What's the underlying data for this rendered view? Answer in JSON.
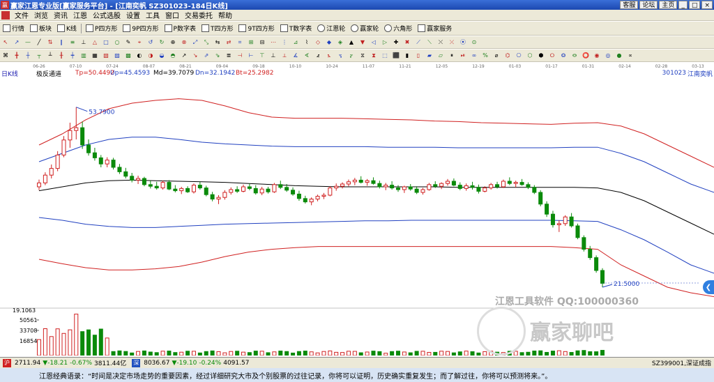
{
  "titlebar": {
    "title": "赢家江恩专业版[赢家服务平台] - [江南奕帆  SZ301023-184日K线]",
    "buttons": [
      "客服",
      "论坛",
      "主页"
    ]
  },
  "menu": [
    "文件",
    "浏览",
    "资讯",
    "江恩",
    "公式选股",
    "设置",
    "工具",
    "窗口",
    "交易委托",
    "帮助"
  ],
  "toolbar1": [
    "行情",
    "板块",
    "K线",
    "P四方形",
    "9P四方形",
    "P数字表",
    "T四方形",
    "9T四方形",
    "T数字表",
    "江恩轮",
    "赢家轮",
    "六角形",
    "赢家服务"
  ],
  "dates": [
    "06-26",
    "07-10",
    "07-24",
    "08-07",
    "08-21",
    "09-04",
    "09-18",
    "10-10",
    "10-24",
    "11-07",
    "11-21",
    "12-05",
    "12-19",
    "01-03",
    "01-17",
    "01-31",
    "02-14",
    "02-28",
    "03-13"
  ],
  "chartinfo": {
    "period": "日K线",
    "indicator": "极反通道",
    "tp": "Tp=50.4492",
    "up": "Up=45.4593",
    "md": "Md=39.7079",
    "dn": "Dn=32.1942",
    "bt": "Bt=25.2982",
    "code": "301023",
    "name": "江南奕帆"
  },
  "annotations": {
    "high": "53.7900",
    "low": "21.5000",
    "vol_max": "19.1063",
    "vol_ticks": [
      "50561",
      "33708",
      "16854"
    ]
  },
  "watermark": {
    "line1": "江恩工具软件  QQ:100000360",
    "line2": "赢家聊吧"
  },
  "bottombar": {
    "sh_index": "2711.94",
    "sh_change": "▼-18.21",
    "sh_pct": "-0.67%",
    "sh_amount": "3811.44亿",
    "sz_index": "8036.67",
    "sz_change": "▼-19.10",
    "sz_pct": "-0.24%",
    "sz_amount": "4091.57",
    "right": "SZ399001,深证成指"
  },
  "quote": "江恩经典语录：“时间是决定市场走势的重要因素，经过详细研究大市及个别股票的过往记录，你将可以证明，历史确实重复发生；而了解过往，你将可以预测将来。”。",
  "colors": {
    "up": "#d02020",
    "down": "#0a8a0a",
    "channel_outer": "#d02020",
    "channel_inner": "#2040c0",
    "mid": "#000000"
  },
  "chart_data": {
    "type": "candlestick",
    "indicator": "极反通道",
    "ylim": [
      19,
      60
    ],
    "candles": [
      [
        39.5,
        40.8,
        38.9,
        40.2
      ],
      [
        40.2,
        42.1,
        39.8,
        41.6
      ],
      [
        41.6,
        43.5,
        41.0,
        42.8
      ],
      [
        42.8,
        45.9,
        42.3,
        45.2
      ],
      [
        45.2,
        48.6,
        44.8,
        47.9
      ],
      [
        47.9,
        51.0,
        46.5,
        49.6
      ],
      [
        49.6,
        53.79,
        48.0,
        50.1
      ],
      [
        50.1,
        51.2,
        46.3,
        47.0
      ],
      [
        47.0,
        48.0,
        45.1,
        45.6
      ],
      [
        45.6,
        46.5,
        44.2,
        44.7
      ],
      [
        44.7,
        45.2,
        43.0,
        43.6
      ],
      [
        43.6,
        44.8,
        43.0,
        44.3
      ],
      [
        44.3,
        44.7,
        42.6,
        43.0
      ],
      [
        43.0,
        43.6,
        41.8,
        42.2
      ],
      [
        42.2,
        42.9,
        41.0,
        41.4
      ],
      [
        41.4,
        42.0,
        40.3,
        40.7
      ],
      [
        40.7,
        41.5,
        40.0,
        41.0
      ],
      [
        41.0,
        41.3,
        39.6,
        39.9
      ],
      [
        39.9,
        40.6,
        39.2,
        39.6
      ],
      [
        39.6,
        40.4,
        39.0,
        39.3
      ],
      [
        39.3,
        40.6,
        39.0,
        40.3
      ],
      [
        40.3,
        40.7,
        38.9,
        39.1
      ],
      [
        39.1,
        39.8,
        38.5,
        38.8
      ],
      [
        38.8,
        39.5,
        38.2,
        39.2
      ],
      [
        39.2,
        39.6,
        38.4,
        38.6
      ],
      [
        38.6,
        40.1,
        38.3,
        39.8
      ],
      [
        39.8,
        40.4,
        39.0,
        39.3
      ],
      [
        39.3,
        39.7,
        37.8,
        38.1
      ],
      [
        38.1,
        38.6,
        36.9,
        37.3
      ],
      [
        37.3,
        38.0,
        36.4,
        37.6
      ],
      [
        37.6,
        38.9,
        37.2,
        38.5
      ],
      [
        38.5,
        39.4,
        38.1,
        39.0
      ],
      [
        39.0,
        39.6,
        38.4,
        38.7
      ],
      [
        38.7,
        39.9,
        38.5,
        39.5
      ],
      [
        39.5,
        40.1,
        38.9,
        39.2
      ],
      [
        39.2,
        39.8,
        38.1,
        38.4
      ],
      [
        38.4,
        39.5,
        38.0,
        39.1
      ],
      [
        39.1,
        39.5,
        38.3,
        38.6
      ],
      [
        38.6,
        40.2,
        38.4,
        39.9
      ],
      [
        39.9,
        40.6,
        39.1,
        39.4
      ],
      [
        39.4,
        40.0,
        38.6,
        38.9
      ],
      [
        38.9,
        39.4,
        37.9,
        38.2
      ],
      [
        38.2,
        38.8,
        37.0,
        37.4
      ],
      [
        37.4,
        37.9,
        36.5,
        36.8
      ],
      [
        36.8,
        37.6,
        36.2,
        37.3
      ],
      [
        37.3,
        38.1,
        36.9,
        37.8
      ],
      [
        37.8,
        38.4,
        37.3,
        38.0
      ],
      [
        38.0,
        39.6,
        37.8,
        39.3
      ],
      [
        39.3,
        40.1,
        38.8,
        39.6
      ],
      [
        39.6,
        40.3,
        39.2,
        40.0
      ],
      [
        40.0,
        40.8,
        39.6,
        40.4
      ],
      [
        40.4,
        41.1,
        39.8,
        40.7
      ],
      [
        40.7,
        41.4,
        40.1,
        40.3
      ],
      [
        40.3,
        40.9,
        39.7,
        40.6
      ],
      [
        40.6,
        41.2,
        39.9,
        40.1
      ],
      [
        40.1,
        40.6,
        39.2,
        39.5
      ],
      [
        39.5,
        40.2,
        38.9,
        39.8
      ],
      [
        39.8,
        40.5,
        39.0,
        39.3
      ],
      [
        39.3,
        39.8,
        38.6,
        39.0
      ],
      [
        39.0,
        39.7,
        38.4,
        39.5
      ],
      [
        39.5,
        40.0,
        38.8,
        39.1
      ],
      [
        39.1,
        39.6,
        38.2,
        38.5
      ],
      [
        38.5,
        39.3,
        38.1,
        39.0
      ],
      [
        39.0,
        40.2,
        38.8,
        39.9
      ],
      [
        39.9,
        40.5,
        39.3,
        39.6
      ],
      [
        39.6,
        40.3,
        39.1,
        40.1
      ],
      [
        40.1,
        40.9,
        39.7,
        40.5
      ],
      [
        40.5,
        41.0,
        39.6,
        39.8
      ],
      [
        39.8,
        40.3,
        38.9,
        39.2
      ],
      [
        39.2,
        40.1,
        38.8,
        39.7
      ],
      [
        39.7,
        40.4,
        39.0,
        39.4
      ],
      [
        39.4,
        39.9,
        38.3,
        38.7
      ],
      [
        38.7,
        39.6,
        38.5,
        39.3
      ],
      [
        39.3,
        40.2,
        39.0,
        39.9
      ],
      [
        39.9,
        40.4,
        39.2,
        39.5
      ],
      [
        39.5,
        40.8,
        39.3,
        40.5
      ],
      [
        40.5,
        41.2,
        39.8,
        40.1
      ],
      [
        40.1,
        40.6,
        39.4,
        40.3
      ],
      [
        40.3,
        40.9,
        39.7,
        39.9
      ],
      [
        39.9,
        40.3,
        39.1,
        39.4
      ],
      [
        39.4,
        39.8,
        38.2,
        38.5
      ],
      [
        38.5,
        38.9,
        36.0,
        36.4
      ],
      [
        36.4,
        36.9,
        34.1,
        34.6
      ],
      [
        34.6,
        35.2,
        32.2,
        32.7
      ],
      [
        32.7,
        33.5,
        31.4,
        32.9
      ],
      [
        32.9,
        34.4,
        32.5,
        34.1
      ],
      [
        34.1,
        34.8,
        32.2,
        32.5
      ],
      [
        32.5,
        32.9,
        30.1,
        30.4
      ],
      [
        30.4,
        30.8,
        27.9,
        28.3
      ],
      [
        28.3,
        28.9,
        26.4,
        26.8
      ],
      [
        26.8,
        27.2,
        24.1,
        24.5
      ],
      [
        24.5,
        24.9,
        21.5,
        22.2
      ]
    ],
    "channel": {
      "tp": [
        47.0,
        49.0,
        51.5,
        53.5,
        54.5,
        55.0,
        55.3,
        55.0,
        54.0,
        52.8,
        52.0,
        51.8,
        51.8,
        51.8,
        51.7,
        51.6,
        51.5,
        51.3,
        51.2,
        51.0,
        50.9,
        50.8,
        50.7,
        50.9,
        51.0,
        50.4,
        49.0,
        47.0,
        45.0,
        43.0
      ],
      "up": [
        44.0,
        45.5,
        47.0,
        48.0,
        48.4,
        48.4,
        48.0,
        47.5,
        47.2,
        47.0,
        46.8,
        46.7,
        46.7,
        46.7,
        46.7,
        46.6,
        46.6,
        46.6,
        46.5,
        46.5,
        46.5,
        46.5,
        46.5,
        46.6,
        46.6,
        45.5,
        44.0,
        42.0,
        40.0,
        38.5
      ],
      "md": [
        38.8,
        39.5,
        40.2,
        40.6,
        40.7,
        40.6,
        40.5,
        40.4,
        40.3,
        40.1,
        39.9,
        39.7,
        39.6,
        39.5,
        39.5,
        39.5,
        39.5,
        39.5,
        39.4,
        39.4,
        39.4,
        39.4,
        39.4,
        39.4,
        39.3,
        38.5,
        37.0,
        35.0,
        33.0,
        31.0
      ],
      "dn": [
        34.0,
        33.5,
        32.8,
        32.4,
        32.2,
        32.2,
        32.4,
        32.6,
        32.8,
        32.9,
        33.0,
        33.1,
        33.2,
        33.3,
        33.4,
        33.4,
        33.5,
        33.5,
        33.5,
        33.5,
        33.5,
        33.5,
        33.5,
        33.4,
        33.3,
        31.8,
        30.0,
        27.8,
        25.5,
        24.0
      ],
      "bt": [
        26.5,
        25.7,
        25.0,
        24.6,
        24.6,
        24.8,
        25.2,
        26.0,
        27.0,
        27.8,
        28.3,
        28.6,
        28.8,
        28.8,
        28.8,
        28.8,
        28.8,
        28.8,
        28.8,
        28.8,
        28.8,
        28.8,
        28.8,
        28.6,
        28.3,
        25.5,
        23.5,
        21.5,
        20.5,
        19.8
      ]
    },
    "volume": {
      "max": 19.1063,
      "ticks": [
        50561,
        33708,
        16854
      ]
    }
  }
}
